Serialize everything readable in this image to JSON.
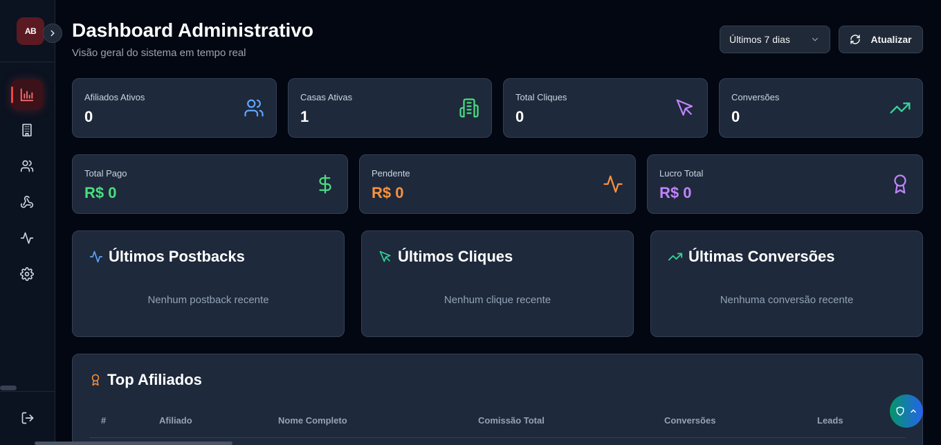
{
  "logo": {
    "text": "AB"
  },
  "sidebar": {
    "items": [
      {
        "icon": "bar-chart-icon",
        "active": true
      },
      {
        "icon": "building-icon",
        "active": false
      },
      {
        "icon": "users-icon",
        "active": false
      },
      {
        "icon": "webhook-icon",
        "active": false
      },
      {
        "icon": "activity-icon",
        "active": false
      },
      {
        "icon": "gear-icon",
        "active": false
      }
    ],
    "logout_icon": "logout-icon"
  },
  "header": {
    "title": "Dashboard Administrativo",
    "subtitle": "Visão geral do sistema em tempo real",
    "period": "Últimos 7 dias",
    "refresh_label": "Atualizar"
  },
  "stats_row1": [
    {
      "label": "Afiliados Ativos",
      "value": "0",
      "icon": "users-icon",
      "color": "#60a5fa"
    },
    {
      "label": "Casas Ativas",
      "value": "1",
      "icon": "building-icon",
      "color": "#4ade80"
    },
    {
      "label": "Total Cliques",
      "value": "0",
      "icon": "cursor-icon",
      "color": "#c084fc"
    },
    {
      "label": "Conversões",
      "value": "0",
      "icon": "trending-up-icon",
      "color": "#34d399"
    }
  ],
  "stats_row2": [
    {
      "label": "Total Pago",
      "value": "R$ 0",
      "icon": "dollar-icon",
      "color": "#4ade80"
    },
    {
      "label": "Pendente",
      "value": "R$ 0",
      "icon": "activity-icon",
      "color": "#fb923c"
    },
    {
      "label": "Lucro Total",
      "value": "R$ 0",
      "icon": "award-icon",
      "color": "#c084fc"
    }
  ],
  "panels": [
    {
      "title": "Últimos Postbacks",
      "empty": "Nenhum postback recente",
      "icon": "activity-icon",
      "color": "#60a5fa"
    },
    {
      "title": "Últimos Cliques",
      "empty": "Nenhum clique recente",
      "icon": "cursor-icon",
      "color": "#34d399"
    },
    {
      "title": "Últimas Conversões",
      "empty": "Nenhuma conversão recente",
      "icon": "trending-up-icon",
      "color": "#34d399"
    }
  ],
  "top_affiliates": {
    "title": "Top Afiliados",
    "icon": "award-icon",
    "color": "#fb923c",
    "columns": [
      "#",
      "Afiliado",
      "Nome Completo",
      "Comissão Total",
      "Conversões",
      "Leads"
    ]
  },
  "fab": {
    "icons": [
      "shield-icon",
      "chevron-up-icon"
    ]
  }
}
